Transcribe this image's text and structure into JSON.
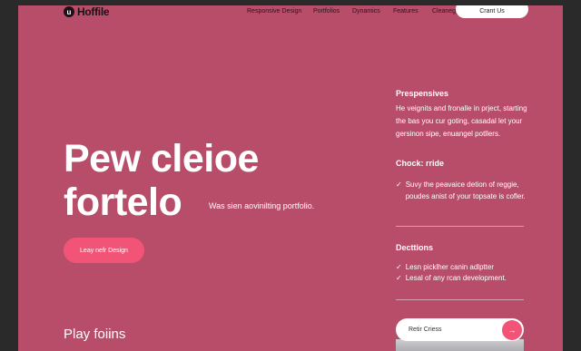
{
  "header": {
    "logo_mark": "u",
    "logo_text": "Hoffile",
    "nav": [
      "Responsive Design",
      "Portfolios",
      "Dynamics",
      "Features",
      "Cleanegy"
    ],
    "contact_label": "Crant Us"
  },
  "hero": {
    "line1": "Pew cleioe",
    "line2": "fortelo",
    "tagline": "Was sien aovinilting portfolio.",
    "cta_label": "Leay nefr Design",
    "bottom_title": "Play foiins"
  },
  "right": {
    "heading1": "Prespensives",
    "para1": "He veignits and fronalle in prject, starting the bas you cur goting, casadal let your gersinon sipe, enuangel potllers.",
    "heading2": "Chock: rride",
    "checks1": [
      "Suvy the peavaice detion of reggie, poudes anist of your topsate is cofler."
    ],
    "heading3": "Decttions",
    "checks2": [
      "Lesn picklher canin adlptter",
      "Lesal of any rcan development."
    ],
    "search_label": "Retir Criess",
    "search_arrow": "→"
  },
  "colors": {
    "page_bg": "#b74d68",
    "accent": "#f25478",
    "frame": "#2b2a2b"
  }
}
